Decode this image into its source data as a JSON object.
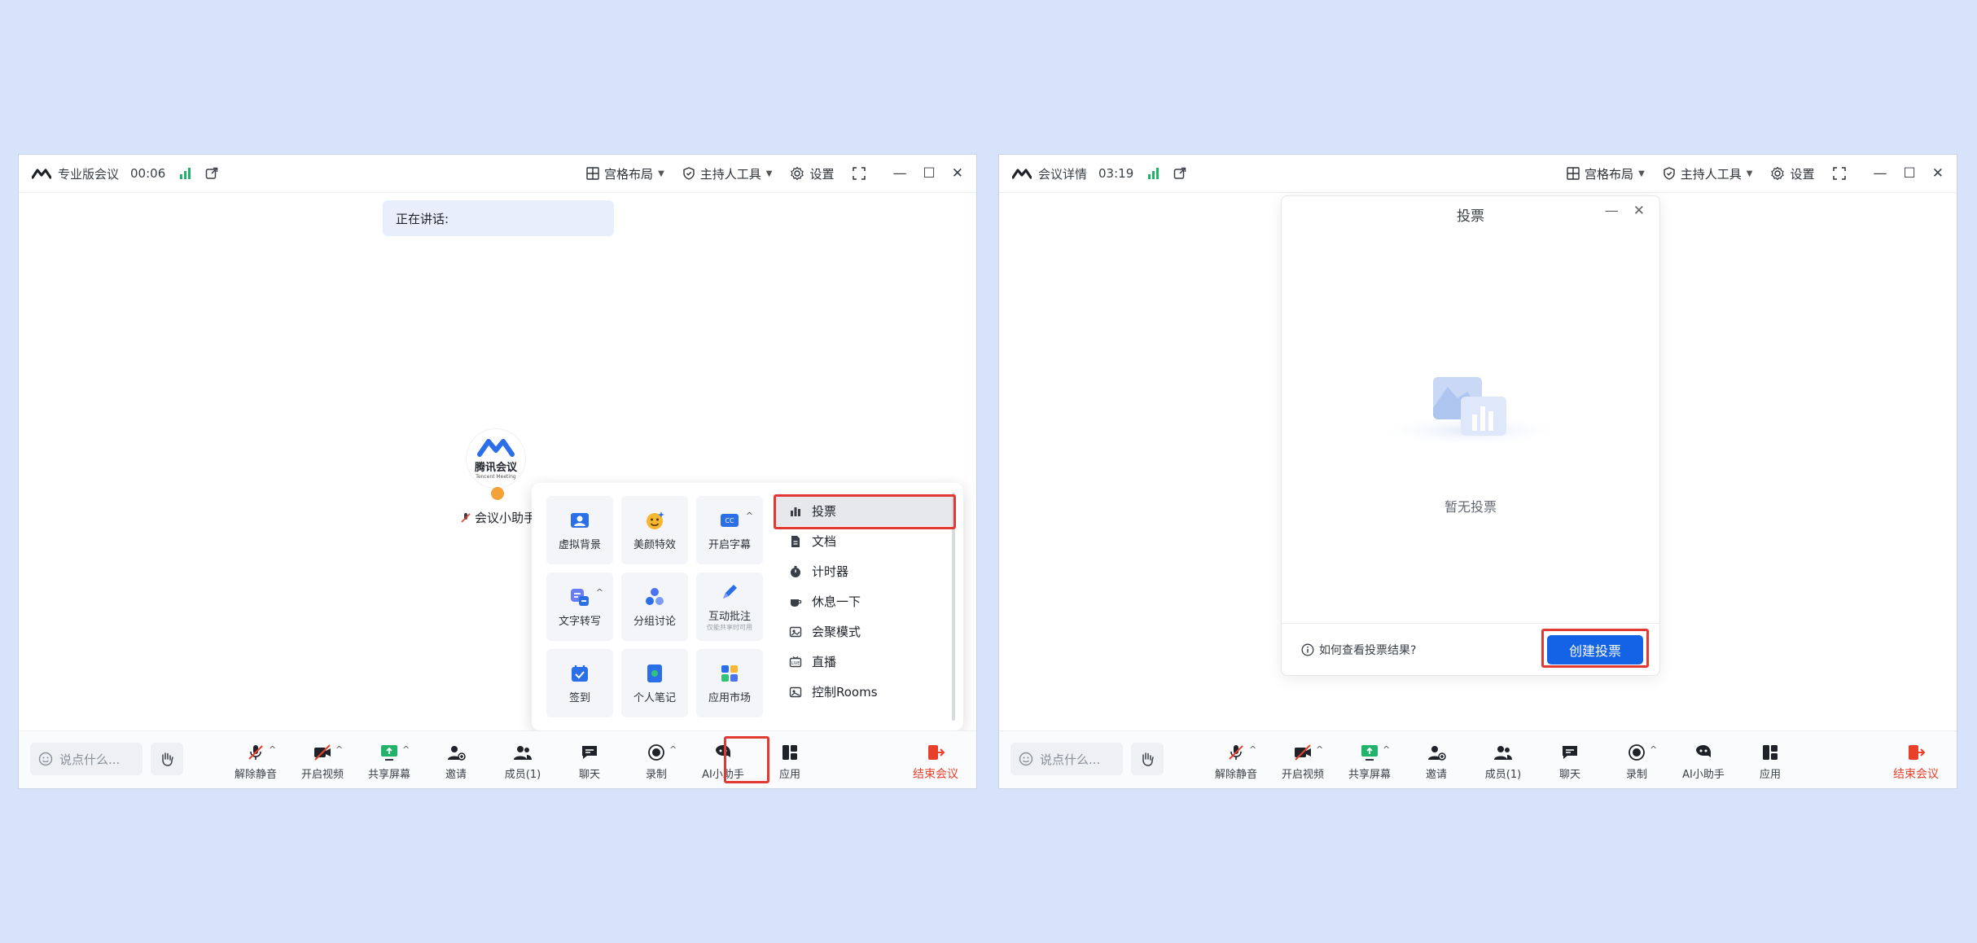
{
  "left": {
    "meeting_title": "专业版会议",
    "timer": "00:06",
    "header": {
      "layout": "宫格布局",
      "host_tools": "主持人工具",
      "settings": "设置"
    },
    "speaking_label": "正在讲话:",
    "assistant": {
      "logo_name": "腾讯会议",
      "logo_sub": "Tencent Meeting",
      "name": "会议小助手"
    },
    "apps_grid": [
      {
        "label": "虚拟背景",
        "icon": "virtual-background-icon"
      },
      {
        "label": "美颜特效",
        "icon": "beauty-icon"
      },
      {
        "label": "开启字幕",
        "icon": "captions-icon"
      },
      {
        "label": "文字转写",
        "icon": "transcribe-icon"
      },
      {
        "label": "分组讨论",
        "icon": "breakout-icon"
      },
      {
        "label": "互动批注",
        "sub": "仅能共享时可用",
        "icon": "annotate-icon"
      },
      {
        "label": "签到",
        "icon": "checkin-icon"
      },
      {
        "label": "个人笔记",
        "icon": "notes-icon"
      },
      {
        "label": "应用市场",
        "icon": "app-market-icon"
      }
    ],
    "apps_list": [
      {
        "label": "投票",
        "icon": "poll-icon"
      },
      {
        "label": "文档",
        "icon": "document-icon"
      },
      {
        "label": "计时器",
        "icon": "timer-icon"
      },
      {
        "label": "休息一下",
        "icon": "coffee-icon"
      },
      {
        "label": "会聚模式",
        "icon": "gallery-icon"
      },
      {
        "label": "直播",
        "icon": "live-icon"
      },
      {
        "label": "控制Rooms",
        "icon": "rooms-icon"
      }
    ]
  },
  "right": {
    "meeting_title": "会议详情",
    "timer": "03:19",
    "header": {
      "layout": "宫格布局",
      "host_tools": "主持人工具",
      "settings": "设置"
    },
    "poll": {
      "title": "投票",
      "empty": "暂无投票",
      "help": "如何查看投票结果?",
      "create": "创建投票"
    }
  },
  "toolbar": {
    "chat_placeholder": "说点什么...",
    "mute": "解除静音",
    "video": "开启视频",
    "share": "共享屏幕",
    "invite": "邀请",
    "members": "成员(1)",
    "chat": "聊天",
    "record": "录制",
    "ai": "AI小助手",
    "apps": "应用",
    "end": "结束会议"
  },
  "colors": {
    "accent": "#1463e6",
    "danger": "#e9402b",
    "signal": "#22b36b",
    "highlight": "#e03a32",
    "background": "#d7e3fb"
  }
}
